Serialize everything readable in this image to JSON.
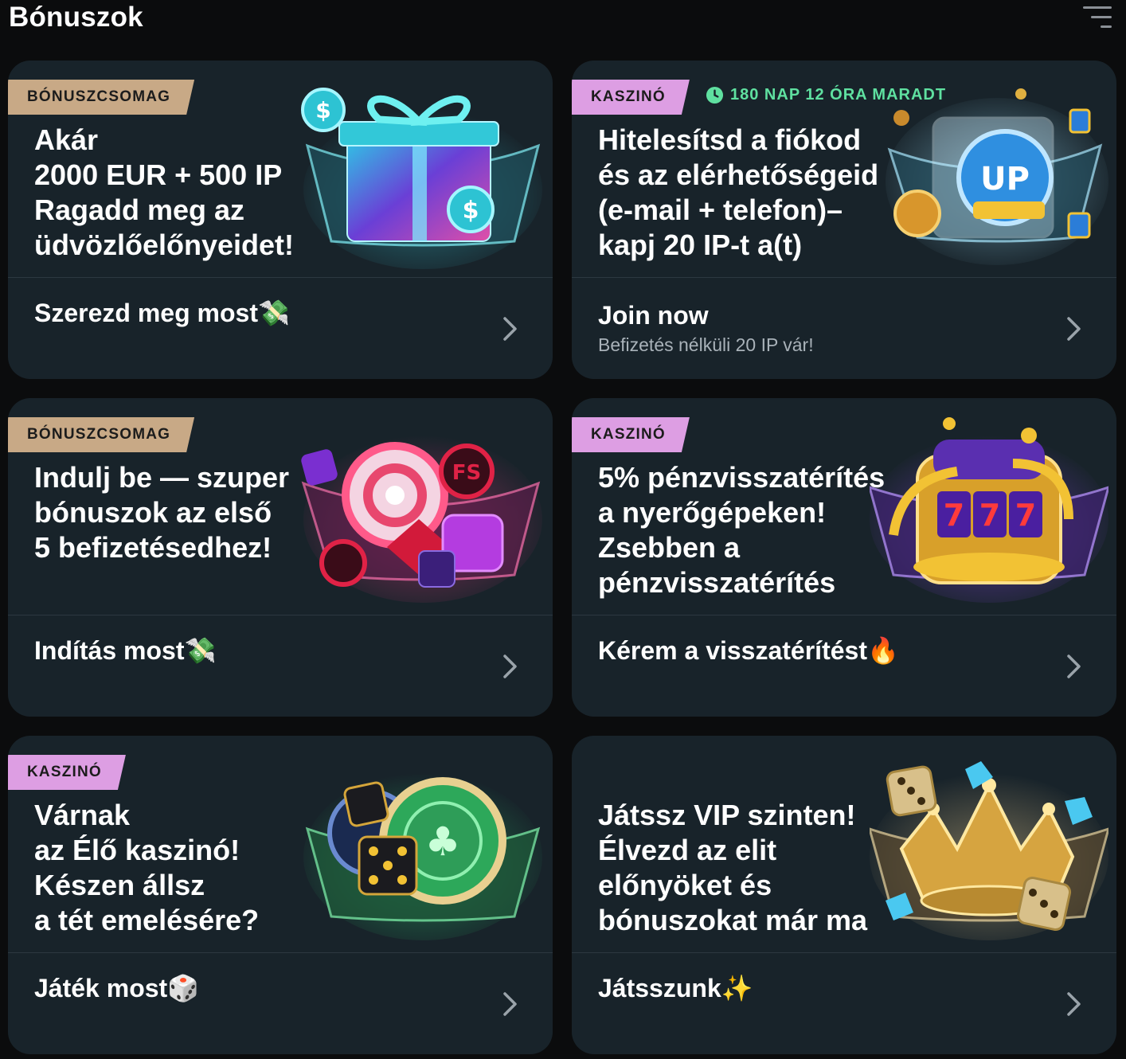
{
  "header": {
    "title": "Bónuszok",
    "filter_icon": "filter-icon"
  },
  "cards": [
    {
      "tag": "BÓNUSZCSOMAG",
      "title": "Akár\n2000 EUR + 500 IP\nRagadd meg az\nüdvözlőelőnyeidet!",
      "cta": "Szerezd meg most💸",
      "art": "gift-box-icon"
    },
    {
      "tag": "KASZINÓ",
      "timer": "180 NAP 12 ÓRA MARADT",
      "title": "Hitelesítsd a fiókod\nés az elérhetőségeid\n(e-mail + telefon)–\nkapj 20 IP-t a(t)",
      "cta": "Join now",
      "cta_sub": "Befizetés nélküli 20 IP vár!",
      "art": "coin-up-icon"
    },
    {
      "tag": "BÓNUSZCSOMAG",
      "title": "Indulj be — szuper\nbónuszok az első\n5 befizetésedhez!",
      "cta": "Indítás most💸",
      "art": "candy-chips-icon"
    },
    {
      "tag": "KASZINÓ",
      "title": "5% pénzvisszatérítés\na nyerőgépeken!\nZsebben a\npénzvisszatérítés",
      "cta": "Kérem a visszatérítést🔥",
      "art": "slot-machine-icon"
    },
    {
      "tag": "KASZINÓ",
      "title": "Várnak\naz Élő kaszinó!\nKészen állsz\na tét emelésére?",
      "cta": "Játék most🎲",
      "art": "casino-chips-icon"
    },
    {
      "title": "Játssz VIP szinten!\nÉlvezd az elit\nelőnyöket és\nbónuszokat már ma",
      "cta": "Játsszunk✨",
      "art": "crown-icon"
    }
  ],
  "colors": {
    "background": "#0b0c0d",
    "card": "#18232a",
    "tag_bonus": "#c8a986",
    "tag_casino": "#dd9ee3",
    "timer": "#5fe0a0"
  }
}
